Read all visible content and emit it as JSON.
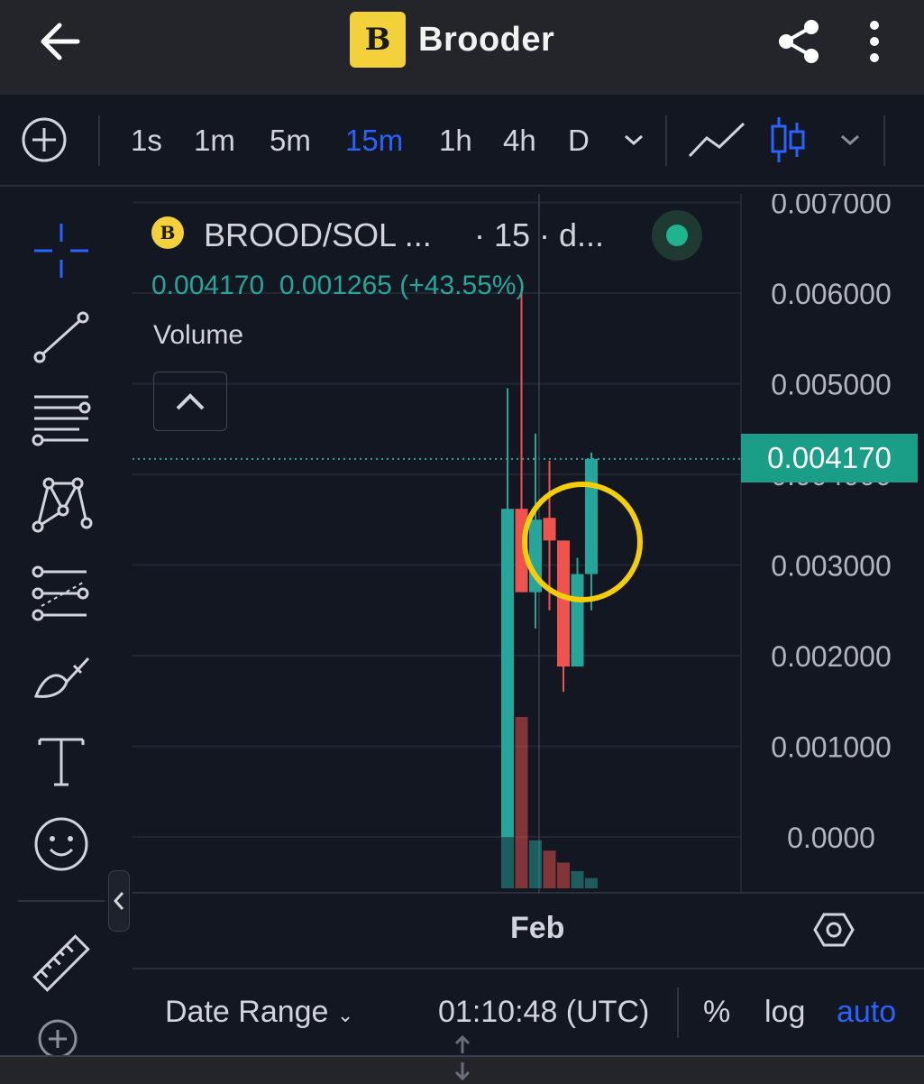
{
  "header": {
    "app_name": "Brooder",
    "logo_letter": "B",
    "icons": [
      "arrow-left-icon",
      "share-icon",
      "more-vertical-icon"
    ]
  },
  "toolbar": {
    "intervals": [
      "1s",
      "1m",
      "5m",
      "15m",
      "1h",
      "4h",
      "D"
    ],
    "active_interval": "15m",
    "accent_color": "#2962ff"
  },
  "legend": {
    "symbol": "BROOD/SOL ...",
    "interval": "· 15 · d...",
    "last_price": "0.004170",
    "change": "0.001265",
    "change_pct": "(+43.55%)",
    "volume_label": "Volume"
  },
  "chart_data": {
    "type": "candlestick",
    "price_axis_labels": [
      "0.007000",
      "0.006000",
      "0.005000",
      "0.004000",
      "0.003000",
      "0.002000",
      "0.001000",
      "0.0000"
    ],
    "ylim": [
      0.0,
      0.007
    ],
    "current_price": 0.00417,
    "x_label": "Feb",
    "up_color": "#26a69a",
    "down_color": "#ef5350",
    "candles": [
      {
        "open": 0.0,
        "high": 0.00495,
        "low": 0.0,
        "close": 0.00362,
        "dir": "up",
        "vol": 0.62
      },
      {
        "open": 0.00362,
        "high": 0.00605,
        "low": 0.0027,
        "close": 0.0027,
        "dir": "down",
        "vol": 1.0
      },
      {
        "open": 0.0027,
        "high": 0.00445,
        "low": 0.0023,
        "close": 0.0035,
        "dir": "up",
        "vol": 0.28
      },
      {
        "open": 0.00352,
        "high": 0.00415,
        "low": 0.0025,
        "close": 0.00327,
        "dir": "down",
        "vol": 0.22
      },
      {
        "open": 0.00327,
        "high": 0.00327,
        "low": 0.0016,
        "close": 0.00188,
        "dir": "down",
        "vol": 0.15
      },
      {
        "open": 0.00188,
        "high": 0.00308,
        "low": 0.00188,
        "close": 0.0029,
        "dir": "up",
        "vol": 0.1
      },
      {
        "open": 0.0029,
        "high": 0.00424,
        "low": 0.0025,
        "close": 0.00417,
        "dir": "up",
        "vol": 0.06
      }
    ]
  },
  "annotation": {
    "highlight_color": "#f5cd0a"
  },
  "bottom": {
    "date_range": "Date Range",
    "clock": "01:10:48 (UTC)",
    "percent": "%",
    "log": "log",
    "auto": "auto"
  }
}
